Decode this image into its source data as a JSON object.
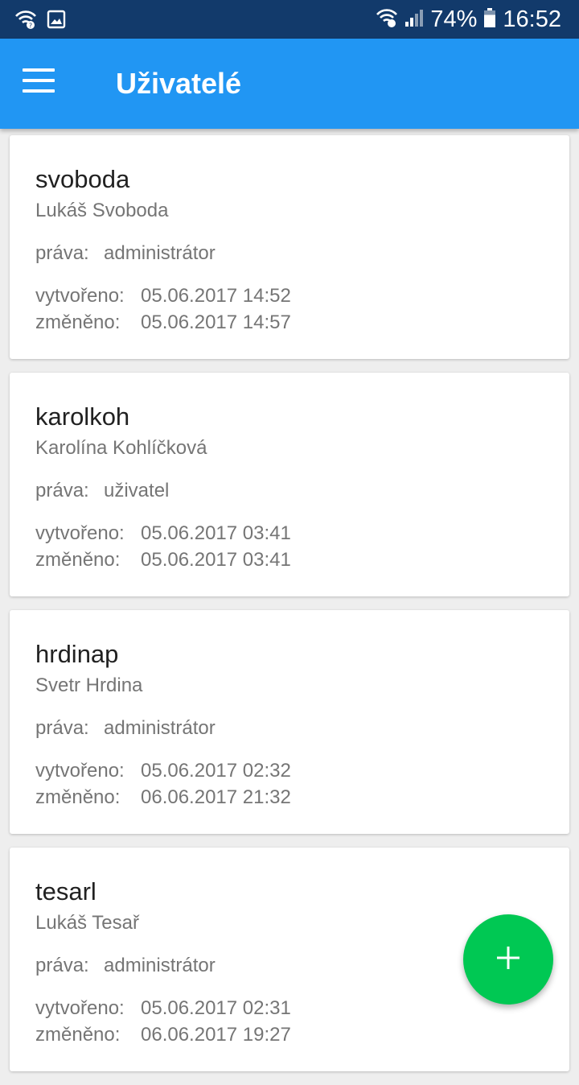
{
  "status_bar": {
    "left_icons": [
      "wifi-calling-icon",
      "image-notification-icon"
    ],
    "right_icons": [
      "wifi-calling-icon",
      "signal-icon",
      "battery-icon"
    ],
    "battery": "74%",
    "time": "16:52"
  },
  "app_bar": {
    "title": "Uživatelé",
    "menu_icon": "hamburger-menu-icon"
  },
  "users": [
    {
      "username": "svoboda",
      "full_name": "Lukáš Svoboda",
      "rights_label": "práva:",
      "rights": "administrátor",
      "created_label": "vytvořeno:",
      "created": "05.06.2017 14:52",
      "modified_label": "změněno:",
      "modified": "05.06.2017 14:57"
    },
    {
      "username": "karolkoh",
      "full_name": "Karolína Kohlíčková",
      "rights_label": "práva:",
      "rights": "uživatel",
      "created_label": "vytvořeno:",
      "created": "05.06.2017 03:41",
      "modified_label": "změněno:",
      "modified": "05.06.2017 03:41"
    },
    {
      "username": "hrdinap",
      "full_name": "Svetr Hrdina",
      "rights_label": "práva:",
      "rights": "administrátor",
      "created_label": "vytvořeno:",
      "created": "05.06.2017 02:32",
      "modified_label": "změněno:",
      "modified": "06.06.2017 21:32"
    },
    {
      "username": "tesarl",
      "full_name": "Lukáš Tesař",
      "rights_label": "práva:",
      "rights": "administrátor",
      "created_label": "vytvořeno:",
      "created": "05.06.2017 02:31",
      "modified_label": "změněno:",
      "modified": "06.06.2017 19:27"
    }
  ],
  "fab": {
    "icon": "plus-icon"
  },
  "colors": {
    "status_bar": "#123a6b",
    "app_bar": "#2196f3",
    "fab": "#00c853",
    "background": "#eeeeee"
  }
}
